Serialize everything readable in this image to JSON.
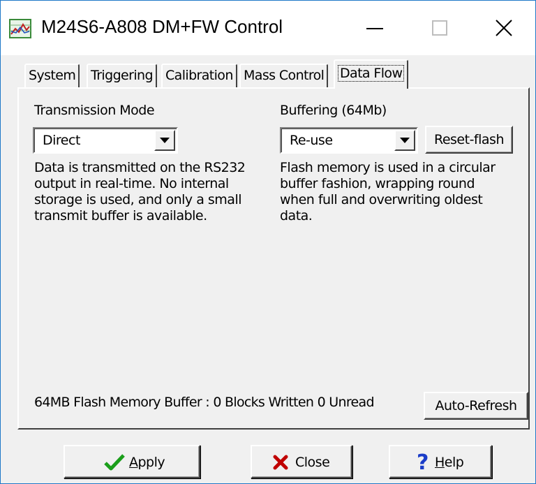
{
  "window": {
    "title": "M24S6-A808 DM+FW Control",
    "icon": "chart-app-icon"
  },
  "title_buttons": {
    "minimize": "minimize-icon",
    "maximize": "maximize-icon",
    "close": "close-icon"
  },
  "tabs": [
    {
      "label": "System"
    },
    {
      "label": "Triggering"
    },
    {
      "label": "Calibration"
    },
    {
      "label": "Mass Control"
    },
    {
      "label": "Data Flow",
      "active": true
    }
  ],
  "transmission": {
    "label": "Transmission Mode",
    "value": "Direct",
    "description": [
      "Data is transmitted on the RS232",
      "output in real-time. No internal",
      "storage is used, and only a small",
      "transmit buffer is available."
    ]
  },
  "buffering": {
    "label": "Buffering (64Mb)",
    "value": "Re-use",
    "reset_button": "Reset-flash",
    "description": [
      "Flash memory is used in a circular",
      "buffer fashion, wrapping round",
      "when full and overwriting oldest",
      "data."
    ]
  },
  "status": {
    "text": "64MB Flash Memory Buffer : 0 Blocks Written  0 Unread",
    "auto_refresh_button": "Auto-Refresh"
  },
  "buttons": {
    "apply": {
      "label_first": "A",
      "label_rest": "pply",
      "icon": "checkmark-icon"
    },
    "close": {
      "label": "Close",
      "icon": "x-icon"
    },
    "help": {
      "label_first": "H",
      "label_rest": "elp",
      "icon": "question-mark-icon"
    }
  },
  "colors": {
    "apply_check": "#1a9e1a",
    "close_x": "#c00000",
    "help_q": "#1a3cc8",
    "window_border": "#1e78c8"
  }
}
